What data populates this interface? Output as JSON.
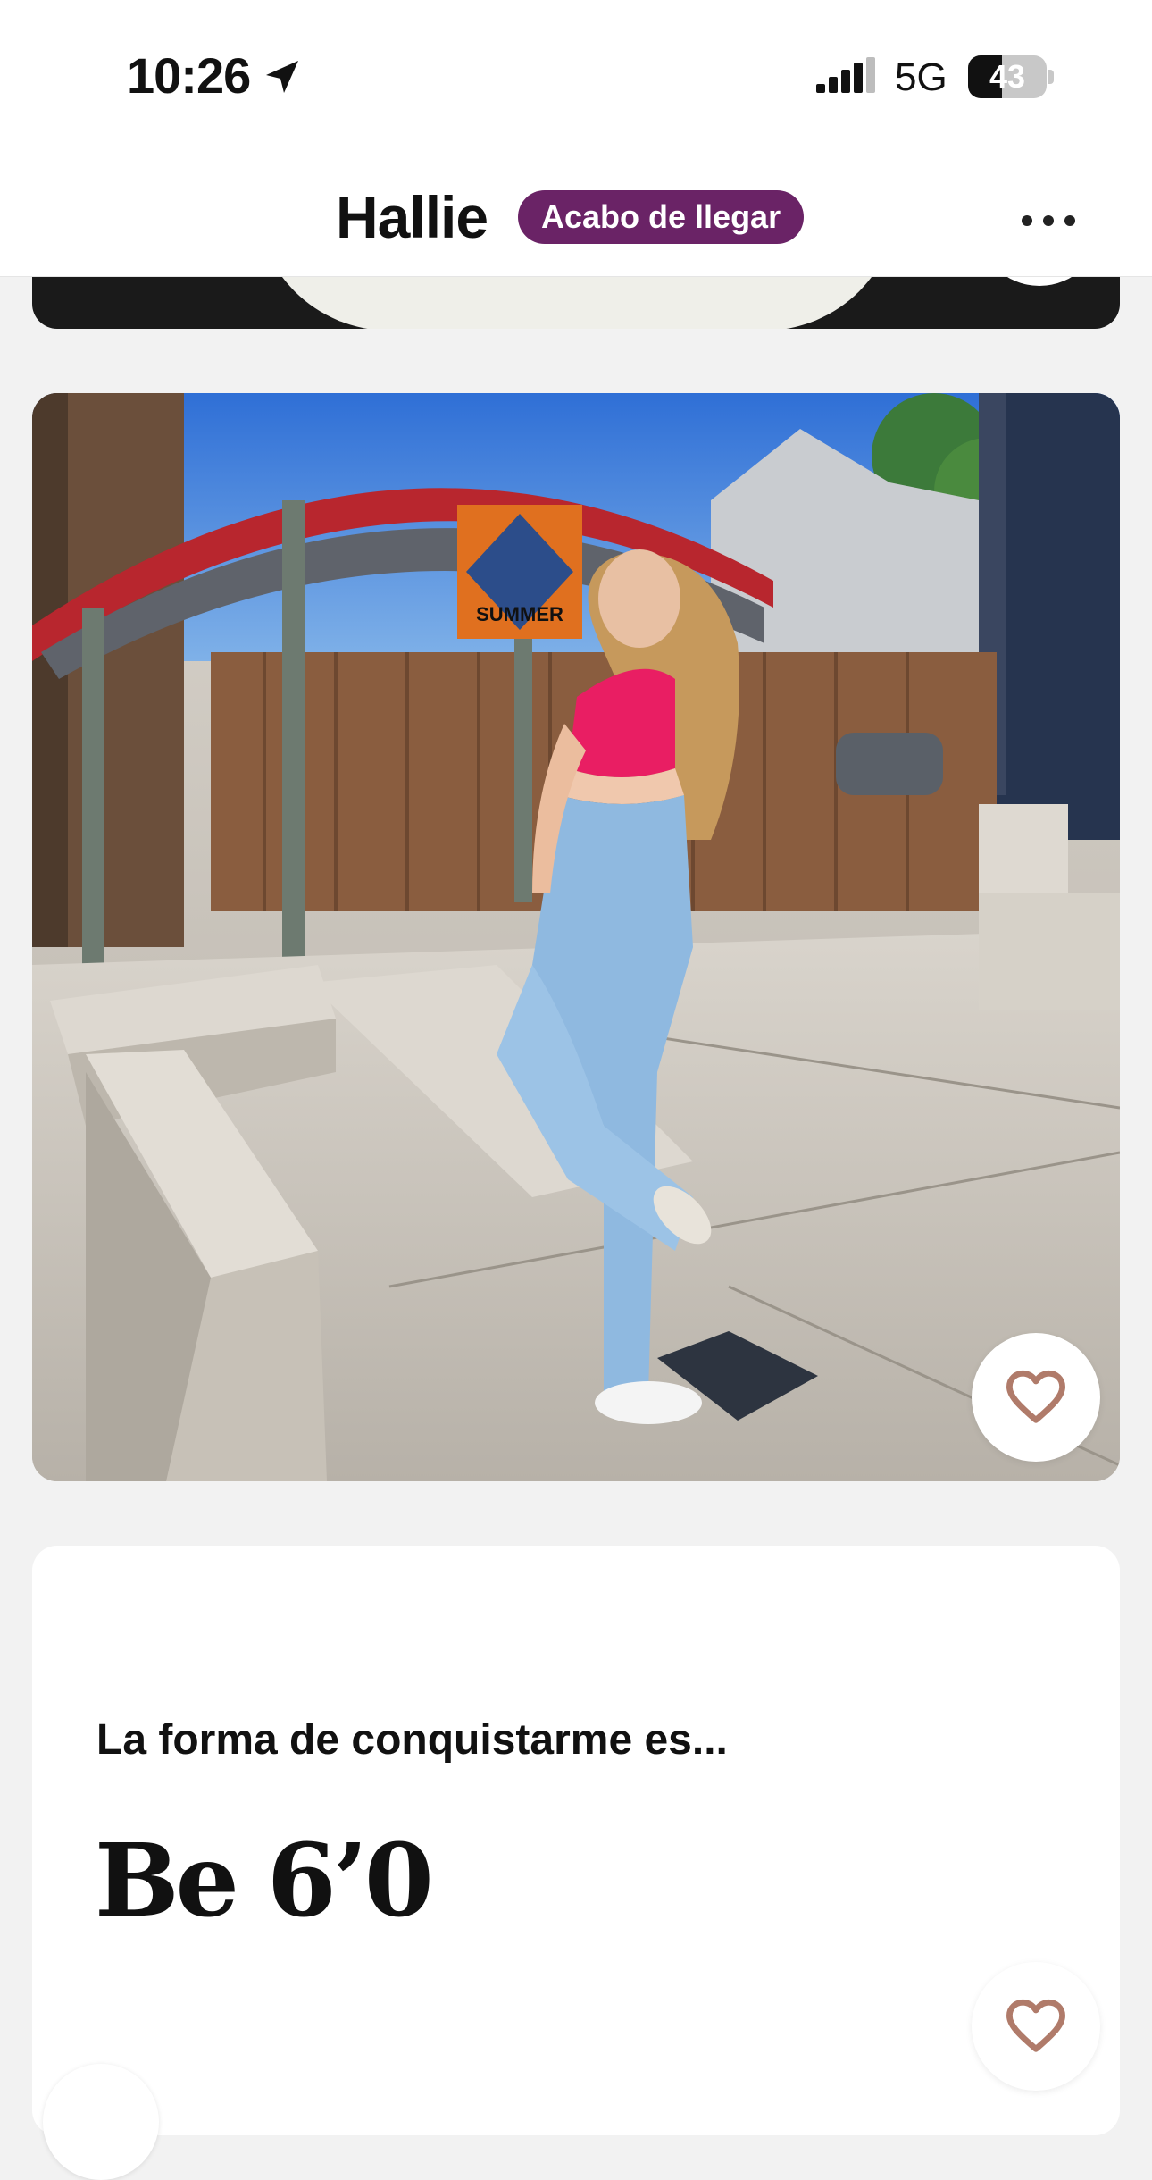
{
  "status_bar": {
    "time": "10:26",
    "network": "5G",
    "battery": "43",
    "battery_level": 0.43,
    "location_icon": "location-arrow-icon",
    "signal_icon": "cellular-signal-icon"
  },
  "header": {
    "name": "Hallie",
    "badge": "Acabo de llegar",
    "badge_color": "#6a2366",
    "more_icon": "more-horizontal-icon"
  },
  "photo": {
    "like_icon": "heart-outline-icon",
    "sign_text": "SUMMER"
  },
  "prompt": {
    "question": "La forma de conquistarme es...",
    "answer": "Be 6’0",
    "like_icon": "heart-outline-icon"
  },
  "colors": {
    "accent": "#6a2366",
    "heart": "#b07b6a",
    "background": "#f2f2f2"
  }
}
